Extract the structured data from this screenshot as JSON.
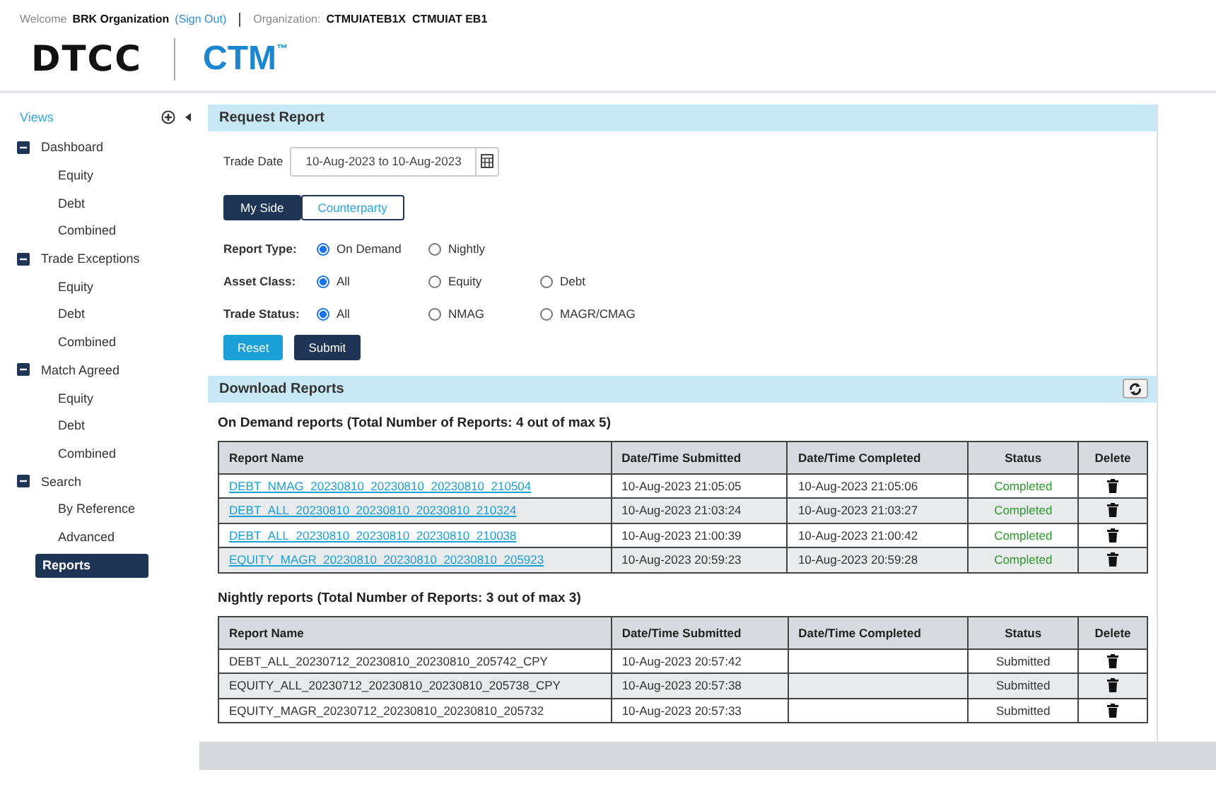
{
  "header": {
    "welcome": "Welcome",
    "user": "BRK Organization",
    "sign_out": "(Sign Out)",
    "org_label": "Organization:",
    "org_value": "CTMUIATEB1X  CTMUIAT EB1"
  },
  "logo": {
    "brand": "DTCC",
    "product": "CTM",
    "mark": "™"
  },
  "sidebar": {
    "title": "Views",
    "items": [
      {
        "label": "Dashboard",
        "expanded": true,
        "children": [
          {
            "label": "Equity",
            "selected": false
          },
          {
            "label": "Debt",
            "selected": false
          },
          {
            "label": "Combined",
            "selected": false
          }
        ]
      },
      {
        "label": "Trade Exceptions",
        "expanded": true,
        "children": [
          {
            "label": "Equity",
            "selected": false
          },
          {
            "label": "Debt",
            "selected": false
          },
          {
            "label": "Combined",
            "selected": false
          }
        ]
      },
      {
        "label": "Match Agreed",
        "expanded": true,
        "children": [
          {
            "label": "Equity",
            "selected": false
          },
          {
            "label": "Debt",
            "selected": false
          },
          {
            "label": "Combined",
            "selected": false
          }
        ]
      },
      {
        "label": "Search",
        "expanded": true,
        "children": [
          {
            "label": "By Reference",
            "selected": false
          },
          {
            "label": "Advanced",
            "selected": false
          }
        ]
      },
      {
        "label": "Reports",
        "selected": true
      }
    ]
  },
  "request_report": {
    "title": "Request Report",
    "trade_date_label": "Trade Date",
    "trade_date": "10-Aug-2023 to 10-Aug-2023",
    "side_toggle": [
      {
        "label": "My Side",
        "selected": true
      },
      {
        "label": "Counterparty",
        "selected": false
      }
    ],
    "radio_groups": [
      {
        "label": "Report Type:",
        "options": [
          {
            "label": "On Demand",
            "selected": true
          },
          {
            "label": "Nightly",
            "selected": false
          }
        ]
      },
      {
        "label": "Asset Class:",
        "options": [
          {
            "label": "All",
            "selected": true
          },
          {
            "label": "Equity",
            "selected": false
          },
          {
            "label": "Debt",
            "selected": false
          }
        ]
      },
      {
        "label": "Trade Status:",
        "options": [
          {
            "label": "All",
            "selected": true
          },
          {
            "label": "NMAG",
            "selected": false
          },
          {
            "label": "MAGR/CMAG",
            "selected": false
          }
        ]
      }
    ],
    "buttons": [
      {
        "label": "Reset",
        "kind": "secondary"
      },
      {
        "label": "Submit",
        "kind": "primary"
      }
    ]
  },
  "download_reports": {
    "title": "Download Reports",
    "tables": [
      {
        "caption": "On Demand reports (Total Number of Reports: 4 out of max 5)",
        "columns": [
          "Report Name",
          "Date/Time Submitted",
          "Date/Time Completed",
          "Status",
          "Delete"
        ],
        "rows": [
          {
            "name": "DEBT_NMAG_20230810_20230810_20230810_210504",
            "link": true,
            "submitted": "10-Aug-2023 21:05:05",
            "completed": "10-Aug-2023 21:05:06",
            "status": "Completed",
            "color": "#2a9a2a"
          },
          {
            "name": "DEBT_ALL_20230810_20230810_20230810_210324",
            "link": true,
            "submitted": "10-Aug-2023 21:03:24",
            "completed": "10-Aug-2023 21:03:27",
            "status": "Completed",
            "color": "#2a9a2a"
          },
          {
            "name": "DEBT_ALL_20230810_20230810_20230810_210038",
            "link": true,
            "submitted": "10-Aug-2023 21:00:39",
            "completed": "10-Aug-2023 21:00:42",
            "status": "Completed",
            "color": "#2a9a2a"
          },
          {
            "name": "EQUITY_MAGR_20230810_20230810_20230810_205923",
            "link": true,
            "submitted": "10-Aug-2023 20:59:23",
            "completed": "10-Aug-2023 20:59:28",
            "status": "Completed",
            "color": "#2a9a2a"
          }
        ]
      },
      {
        "caption": "Nightly reports (Total Number of Reports: 3 out of max 3)",
        "columns": [
          "Report Name",
          "Date/Time Submitted",
          "Date/Time Completed",
          "Status",
          "Delete"
        ],
        "rows": [
          {
            "name": "DEBT_ALL_20230712_20230810_20230810_205742_CPY",
            "link": false,
            "submitted": "10-Aug-2023 20:57:42",
            "status": "Submitted",
            "color": "#333333"
          },
          {
            "name": "EQUITY_ALL_20230712_20230810_20230810_205738_CPY",
            "link": false,
            "submitted": "10-Aug-2023 20:57:38",
            "status": "Submitted",
            "color": "#333333"
          },
          {
            "name": "EQUITY_MAGR_20230712_20230810_20230810_205732",
            "link": false,
            "submitted": "10-Aug-2023 20:57:33",
            "status": "Submitted",
            "color": "#333333"
          }
        ]
      }
    ]
  }
}
